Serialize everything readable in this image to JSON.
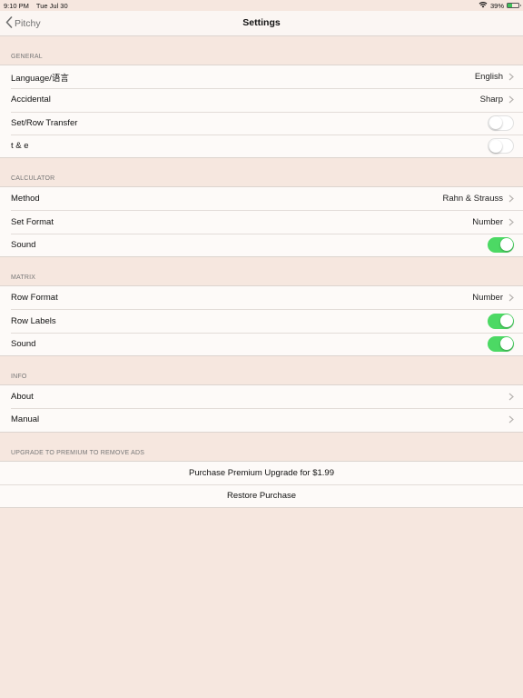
{
  "status_bar": {
    "time": "9:10 PM",
    "date": "Tue Jul 30",
    "battery_percent": "39%",
    "battery_level": 0.39,
    "wifi_icon": "wifi-icon",
    "battery_icon": "battery-icon"
  },
  "nav": {
    "back_label": "Pitchy",
    "title": "Settings"
  },
  "sections": {
    "general": {
      "header": "GENERAL",
      "language": {
        "label": "Language/语言",
        "value": "English"
      },
      "accidental": {
        "label": "Accidental",
        "value": "Sharp"
      },
      "set_row_transfer": {
        "label": "Set/Row Transfer",
        "on": false
      },
      "t_e": {
        "label": "t & e",
        "on": false
      }
    },
    "calculator": {
      "header": "CALCULATOR",
      "method": {
        "label": "Method",
        "value": "Rahn & Strauss"
      },
      "set_format": {
        "label": "Set Format",
        "value": "Number"
      },
      "sound": {
        "label": "Sound",
        "on": true
      }
    },
    "matrix": {
      "header": "MATRIX",
      "row_format": {
        "label": "Row Format",
        "value": "Number"
      },
      "row_labels": {
        "label": "Row Labels",
        "on": true
      },
      "sound": {
        "label": "Sound",
        "on": true
      }
    },
    "info": {
      "header": "INFO",
      "about": {
        "label": "About"
      },
      "manual": {
        "label": "Manual"
      }
    },
    "premium": {
      "header": "UPGRADE TO PREMIUM TO REMOVE ADS",
      "purchase": {
        "label": "Purchase Premium Upgrade for $1.99"
      },
      "restore": {
        "label": "Restore Purchase"
      }
    }
  },
  "colors": {
    "background": "#f6e7df",
    "toggle_on": "#4cd964",
    "chevron": "#b8b4b1"
  }
}
